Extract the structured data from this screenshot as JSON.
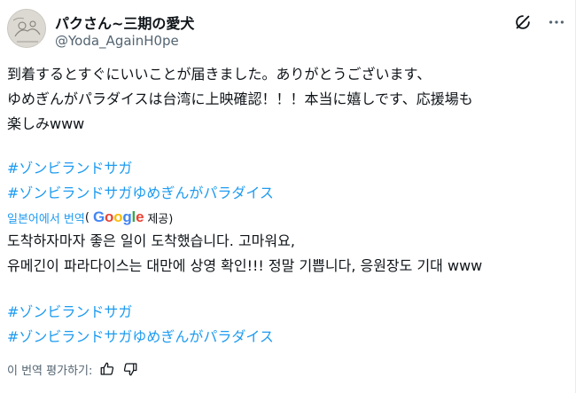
{
  "author": {
    "display_name": "パクさん~三期の愛犬",
    "handle": "@Yoda_AgainH0pe"
  },
  "original": {
    "lines": [
      "到着するとすぐにいいことが届きました。ありがとうございます、",
      "ゆめぎんがパラダイスは台湾に上映確認！！！本当に嬉しです、応援場も",
      "楽しみwww"
    ],
    "hashtags": [
      "#ゾンビランドサガ",
      "#ゾンビランドサガゆめぎんがパラダイス"
    ]
  },
  "translation": {
    "label": "일본어에서 번역",
    "open_paren": "(",
    "google": [
      "G",
      "o",
      "o",
      "g",
      "l",
      "e"
    ],
    "provided": "제공)",
    "lines": [
      "도착하자마자 좋은 일이 도착했습니다. 고마워요,",
      "유메긴이 파라다이스는 대만에 상영 확인!!! 정말 기쁩니다, 응원장도 기대 www"
    ],
    "hashtags": [
      "#ゾンビランドサガ",
      "#ゾンビランドサガゆめぎんがパラダイス"
    ]
  },
  "rate": {
    "label": "이 번역 평가하기:"
  },
  "colors": {
    "link": "#1d9bf0",
    "text": "#0f1419",
    "muted": "#536471"
  },
  "icons": [
    "grok-icon",
    "more-icon",
    "thumbs-up-icon",
    "thumbs-down-icon"
  ]
}
